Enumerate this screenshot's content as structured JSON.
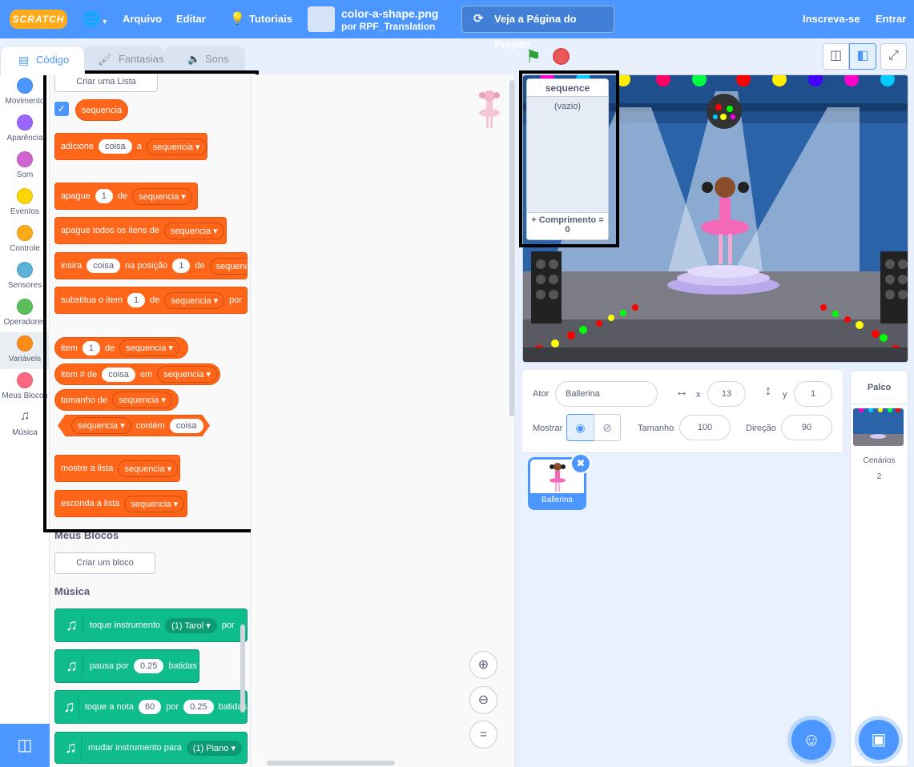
{
  "topbar": {
    "logo": "SCRATCH",
    "menu_file": "Arquivo",
    "menu_edit": "Editar",
    "menu_tutorials": "Tutoriais",
    "project_title": "color-a-shape.png",
    "project_author": "por RPF_Translation",
    "see_project": "Veja a Página do Projeto",
    "signup": "Inscreva-se",
    "signin": "Entrar"
  },
  "tabs": {
    "code": "Código",
    "costumes": "Fantasias",
    "sounds": "Sons"
  },
  "categories": [
    {
      "label": "Movimento",
      "color": "#4c97ff"
    },
    {
      "label": "Aparência",
      "color": "#9966ff"
    },
    {
      "label": "Som",
      "color": "#cf63cf"
    },
    {
      "label": "Eventos",
      "color": "#ffd500"
    },
    {
      "label": "Controle",
      "color": "#ffab19"
    },
    {
      "label": "Sensores",
      "color": "#5cb1d6"
    },
    {
      "label": "Operadores",
      "color": "#59c059"
    },
    {
      "label": "Variáveis",
      "color": "#ff8c1a"
    },
    {
      "label": "Meus Blocos",
      "color": "#ff6680"
    },
    {
      "label": "Música",
      "color": "#0fbd8c"
    }
  ],
  "palette": {
    "make_list": "Criar uma Lista",
    "list_reporter": "sequencia",
    "add": {
      "t1": "adicione",
      "v1": "coisa",
      "t2": "a",
      "dd": "sequencia"
    },
    "delete": {
      "t1": "apague",
      "v1": "1",
      "t2": "de",
      "dd": "sequencia"
    },
    "delete_all": {
      "t1": "apague todos os itens de",
      "dd": "sequencia"
    },
    "insert": {
      "t1": "insira",
      "v1": "coisa",
      "t2": "na posição",
      "v2": "1",
      "t3": "de",
      "dd": "sequencia"
    },
    "replace": {
      "t1": "substitua o item",
      "v1": "1",
      "t2": "de",
      "dd": "sequencia",
      "t3": "por"
    },
    "item": {
      "t1": "item",
      "v1": "1",
      "t2": "de",
      "dd": "sequencia"
    },
    "item_num": {
      "t1": "item # de",
      "v1": "coisa",
      "t2": "em",
      "dd": "sequencia"
    },
    "length": {
      "t1": "tamanho de",
      "dd": "sequencia"
    },
    "contains": {
      "dd": "sequencia",
      "t1": "contém",
      "v1": "coisa",
      "q": "?"
    },
    "show": {
      "t1": "mostre a lista",
      "dd": "sequencia"
    },
    "hide": {
      "t1": "esconda a lista",
      "dd": "sequencia"
    },
    "my_blocks_title": "Meus Blocos",
    "make_block": "Criar um bloco",
    "music_title": "Música",
    "play_drum": {
      "t1": "toque instrumento",
      "dd": "(1) Tarol",
      "t2": "por"
    },
    "rest": {
      "t1": "pausa por",
      "v1": "0.25",
      "t2": "batidas"
    },
    "play_note": {
      "t1": "toque a nota",
      "v1": "60",
      "t2": "por",
      "v2": "0.25",
      "t3": "batidas"
    },
    "set_instrument": {
      "t1": "mudar instrumento para",
      "dd": "(1) Piano"
    }
  },
  "stage": {
    "list_monitor": {
      "title": "sequence",
      "empty": "(vazio)",
      "length_label": "+ Comprimento =",
      "length_value": "0"
    }
  },
  "sprite_info": {
    "sprite_label": "Ator",
    "sprite_name": "Ballerina",
    "x_label": "x",
    "x_value": "13",
    "y_label": "y",
    "y_value": "1",
    "show_label": "Mostrar",
    "size_label": "Tamanho",
    "size_value": "100",
    "direction_label": "Direção",
    "direction_value": "90"
  },
  "sprites": [
    {
      "name": "Ballerina"
    }
  ],
  "stage_panel": {
    "title": "Palco",
    "backdrops_label": "Cenários",
    "backdrops_count": "2"
  },
  "colors": {
    "accent": "#4c97ff",
    "variables": "#ff661a",
    "music": "#0fbd8c",
    "highlight_box": "#000000"
  }
}
